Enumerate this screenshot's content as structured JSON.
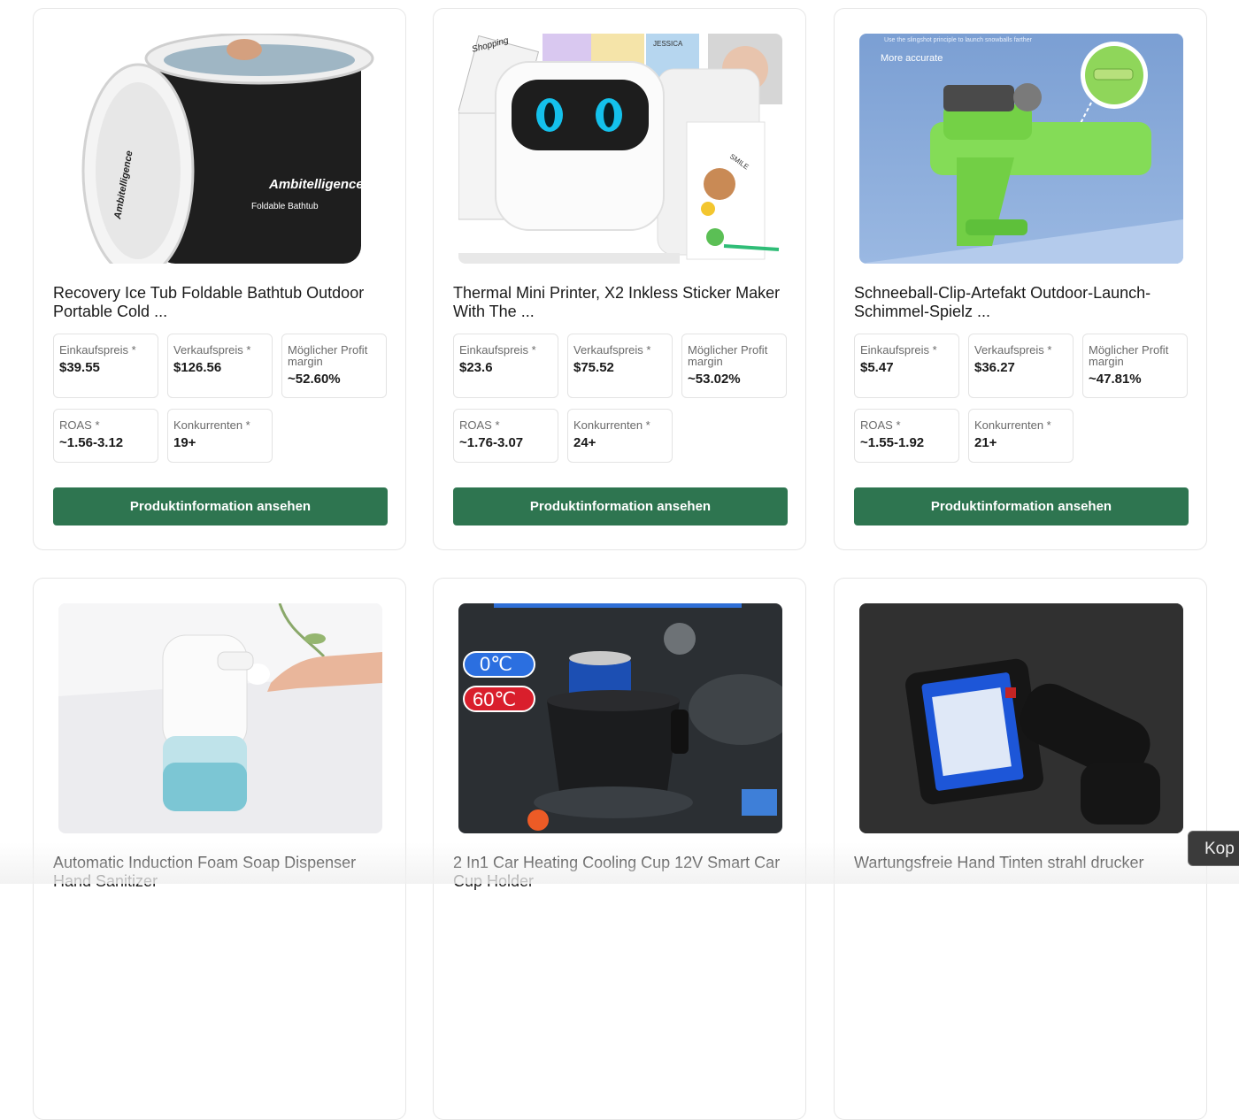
{
  "labels": {
    "purchase": "Einkaufspreis *",
    "sale": "Verkaufspreis *",
    "margin_line1": "Möglicher Profit",
    "margin_line2": "margin",
    "roas": "ROAS *",
    "competitors": "Konkurrenten *",
    "button": "Produktinformation ansehen"
  },
  "products": [
    {
      "title": "Recovery Ice Tub Foldable Bathtub Outdoor Portable Cold ...",
      "purchase": "$39.55",
      "sale": "$126.56",
      "margin": "~52.60%",
      "roas": "~1.56-3.12",
      "competitors": "19+",
      "image_text": {
        "brand": "Ambitelligence",
        "name": "Foldable Bathtub"
      }
    },
    {
      "title": "Thermal Mini Printer, X2 Inkless Sticker Maker With The ...",
      "purchase": "$23.6",
      "sale": "$75.52",
      "margin": "~53.02%",
      "roas": "~1.76-3.07",
      "competitors": "24+",
      "image_text": {
        "tag1": "Shopping",
        "tag2": "JESSICA",
        "tag3": "SMILE"
      }
    },
    {
      "title": "Schneeball-Clip-Artefakt Outdoor-Launch-Schimmel-Spielz ...",
      "purchase": "$5.47",
      "sale": "$36.27",
      "margin": "~47.81%",
      "roas": "~1.55-1.92",
      "competitors": "21+",
      "image_text": {
        "caption": "Use the slingshot principle to launch snowballs farther",
        "tagline": "More accurate"
      }
    },
    {
      "title": "Automatic Induction Foam Soap Dispenser Hand Sanitizer"
    },
    {
      "title": "2 In1 Car Heating Cooling Cup 12V Smart Car Cup Holder",
      "image_text": {
        "cold": "0℃",
        "hot": "60℃"
      }
    },
    {
      "title": "Wartungsfreie Hand Tinten strahl drucker"
    }
  ],
  "overlay": {
    "copy_label": "Kop"
  },
  "colors": {
    "button": "#2e7550",
    "border": "#e6e6e6"
  }
}
